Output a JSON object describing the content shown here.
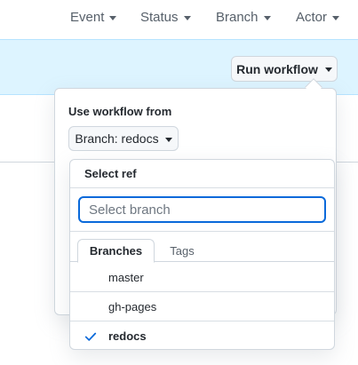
{
  "filters": {
    "event": "Event",
    "status": "Status",
    "branch": "Branch",
    "actor": "Actor"
  },
  "run_workflow": {
    "label": "Run workflow"
  },
  "dialog": {
    "title": "Use workflow from",
    "branch_button": "Branch: redocs"
  },
  "ref_selector": {
    "title": "Select ref",
    "search_placeholder": "Select branch",
    "tabs": [
      {
        "label": "Branches",
        "active": true
      },
      {
        "label": "Tags",
        "active": false
      }
    ],
    "items": [
      {
        "name": "master",
        "selected": false
      },
      {
        "name": "gh-pages",
        "selected": false
      },
      {
        "name": "redocs",
        "selected": true
      }
    ]
  },
  "colors": {
    "accent": "#0969da",
    "banner": "#ddf4ff",
    "border": "#d0d7de"
  }
}
